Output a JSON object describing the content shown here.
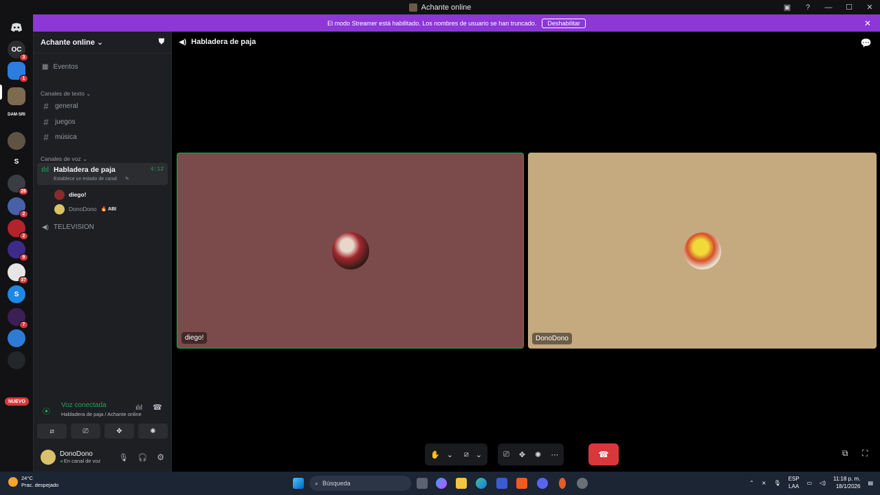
{
  "window": {
    "title": "Achante online"
  },
  "banner": {
    "text": "El modo Streamer está habilitado. Los nombres de usuario se han truncado.",
    "button_label": "Deshabilitar",
    "color": "#8c37d6"
  },
  "servers": {
    "badges": [
      "3",
      "1",
      "26",
      "2",
      "2",
      "9",
      "37",
      "7"
    ],
    "letter_server": "S",
    "new_label": "NUEVO"
  },
  "sidebar": {
    "guild_name": "Achante online",
    "events_label": "Eventos",
    "text_category": "Canales de texto",
    "text_channels": [
      "general",
      "juegos",
      "música"
    ],
    "voice_category": "Canales de voz",
    "active_voice": {
      "name": "Habladera de paja",
      "status": "Establece un estado de canal",
      "timer": "4:12"
    },
    "users": [
      {
        "name": "diego!"
      },
      {
        "name": "DonoDono",
        "tag": "ABI"
      }
    ],
    "other_voice": "TELEVISION"
  },
  "voice_panel": {
    "status": "Voz conectada",
    "location": "Habladera de paja / Achante online"
  },
  "user_panel": {
    "name": "DonoDono",
    "status": "En canal de voz"
  },
  "call": {
    "channel_title": "Habladera de paja",
    "tiles": [
      {
        "name": "diego!",
        "bg": "#7b4a4a"
      },
      {
        "name": "DonoDono",
        "bg": "#c5aa80"
      }
    ]
  },
  "taskbar": {
    "temp": "24°C",
    "weather": "Prac. despejado",
    "search_placeholder": "Búsqueda",
    "lang": "ESP",
    "lang_sub": "LAA",
    "time": "11:18 p. m.",
    "date": "18/1/2026"
  }
}
